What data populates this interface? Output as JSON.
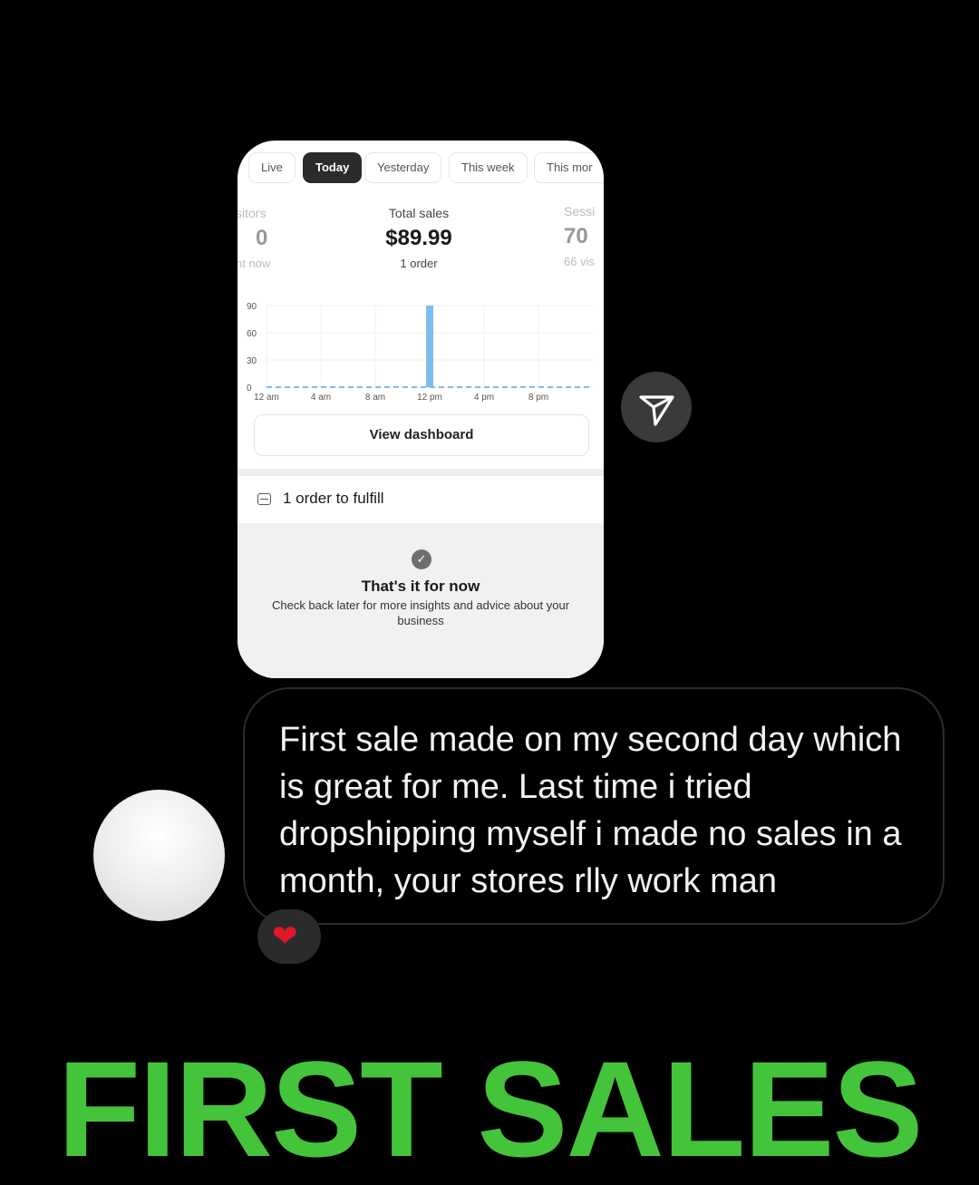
{
  "dashboard": {
    "tabs": [
      {
        "label": "Live",
        "active": false
      },
      {
        "label": "Today",
        "active": true
      },
      {
        "label": "Yesterday",
        "active": false
      },
      {
        "label": "This week",
        "active": false
      },
      {
        "label": "This mor",
        "active": false
      }
    ],
    "visitors": {
      "label": "sitors",
      "value": "0",
      "sub": "nt now"
    },
    "total_sales": {
      "label": "Total sales",
      "value": "$89.99",
      "sub": "1 order"
    },
    "sessions": {
      "label": "Sessi",
      "value": "70",
      "sub": "66 vis"
    },
    "view_dashboard_label": "View dashboard",
    "fulfill_label": "1 order to fulfill",
    "done_title": "That's it for now",
    "done_sub": "Check back later for more insights and advice about your business"
  },
  "chart_data": {
    "type": "bar",
    "x_labels": [
      "12 am",
      "4 am",
      "8 am",
      "12 pm",
      "4 pm",
      "8 pm"
    ],
    "y_ticks": [
      "90",
      "60",
      "30",
      "0"
    ],
    "ylim": [
      0,
      90
    ],
    "bars": [
      {
        "hour": 12,
        "value": 89.99
      }
    ],
    "baseline_dashed": true,
    "bar_color": "#7cbdf0",
    "grid": true
  },
  "comment": {
    "text": "First sale made on my second day which is great for me. Last time i tried dropshipping myself i made no sales in a month, your stores rlly work man",
    "reaction": "❤"
  },
  "icons": {
    "share": "send-icon",
    "reaction": "heart-icon",
    "check": "check-circle-icon",
    "fulfill": "inbox-icon"
  },
  "headline": "FIRST SALES",
  "colors": {
    "headline": "#43c43a",
    "accent_dark": "#2b2b2b"
  }
}
